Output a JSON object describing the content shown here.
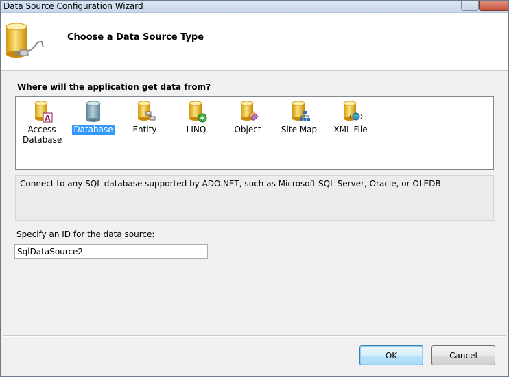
{
  "window": {
    "title": "Data Source Configuration Wizard"
  },
  "header": {
    "title": "Choose a Data Source Type"
  },
  "prompt": "Where will the application get data from?",
  "data_sources": [
    {
      "label": "Access Database",
      "icon": "access-database-icon",
      "selected": false
    },
    {
      "label": "Database",
      "icon": "database-icon",
      "selected": true
    },
    {
      "label": "Entity",
      "icon": "entity-icon",
      "selected": false
    },
    {
      "label": "LINQ",
      "icon": "linq-icon",
      "selected": false
    },
    {
      "label": "Object",
      "icon": "object-icon",
      "selected": false
    },
    {
      "label": "Site Map",
      "icon": "site-map-icon",
      "selected": false
    },
    {
      "label": "XML File",
      "icon": "xml-file-icon",
      "selected": false
    }
  ],
  "description": "Connect to any SQL database supported by ADO.NET, such as Microsoft SQL Server, Oracle, or OLEDB.",
  "id_field": {
    "label": "Specify an ID for the data source:",
    "value": "SqlDataSource2"
  },
  "buttons": {
    "ok": "OK",
    "cancel": "Cancel"
  },
  "colors": {
    "selection": "#3399ff",
    "cylinder": "#f2c12e",
    "database_cylinder": "#7fa6b5"
  }
}
